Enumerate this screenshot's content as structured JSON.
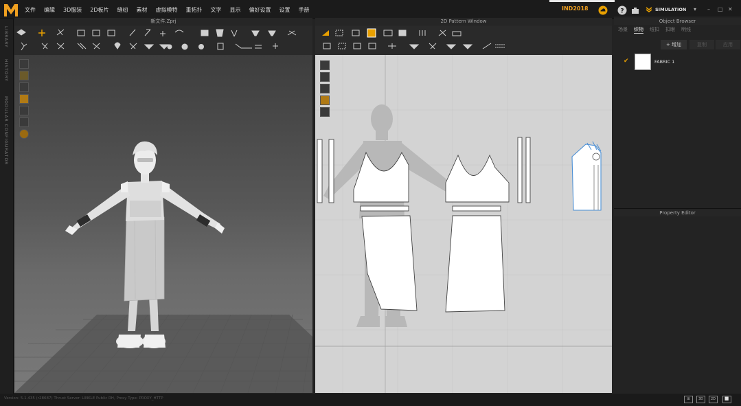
{
  "app": {
    "logo_text": "M",
    "menu": [
      "文件",
      "编辑",
      "3D服装",
      "2D板片",
      "缝纫",
      "素材",
      "虚拟模特",
      "重拓扑",
      "文字",
      "显示",
      "偏好设置",
      "设置",
      "手册"
    ],
    "user": "IND2018",
    "simulation_label": "SIMULATION",
    "window_controls": [
      "▾",
      "–",
      "□",
      "✕"
    ]
  },
  "left_sidebar": {
    "tabs": [
      "LIBRARY",
      "HISTORY",
      "MODULAR CONFIGURATOR"
    ]
  },
  "view3d": {
    "title": "新文件.Zprj"
  },
  "view2d": {
    "title": "2D Pattern Window"
  },
  "object_browser": {
    "title": "Object Browser",
    "tabs": [
      "场景",
      "织物",
      "纽扣",
      "扣眼",
      "明线"
    ],
    "active_tab": "织物",
    "add_label": "+ 增加",
    "copy_label": "复制",
    "apply_label": "应用",
    "fabrics": [
      {
        "name": "FABRIC 1",
        "selected": true,
        "color": "#ffffff"
      }
    ]
  },
  "property_editor": {
    "title": "Property Editor"
  },
  "status_bar": {
    "text": "Version: 5.1.435 (r28687)    Thrust Server: LINKLE Public RH, Proxy Type: PROXY_HTTP",
    "buttons": [
      "⊞",
      "3D",
      "2D",
      "⬜"
    ]
  },
  "colors": {
    "accent": "#f0a020",
    "pattern_fill": "#ffffff",
    "pattern_outline": "#444444",
    "selected_pattern_outline": "#4a8fd6"
  }
}
